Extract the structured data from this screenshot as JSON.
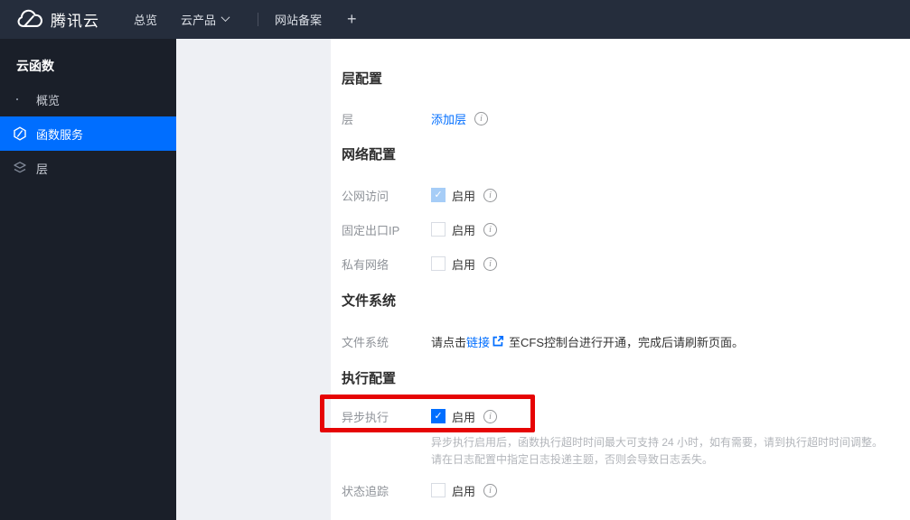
{
  "navbar": {
    "brand": "腾讯云",
    "items": [
      {
        "label": "总览"
      },
      {
        "label": "云产品"
      },
      {
        "label": "网站备案"
      },
      {
        "label": "+"
      }
    ]
  },
  "sidebar": {
    "title": "云函数",
    "items": [
      {
        "label": "概览",
        "active": false
      },
      {
        "label": "函数服务",
        "active": true
      },
      {
        "label": "层",
        "active": false
      }
    ]
  },
  "form": {
    "layer": {
      "heading": "层配置",
      "label": "层",
      "link": "添加层"
    },
    "network": {
      "heading": "网络配置",
      "rows": [
        {
          "label": "公网访问",
          "value": "启用",
          "checkbox_state": "checked-disabled"
        },
        {
          "label": "固定出口IP",
          "value": "启用",
          "checkbox_state": "unchecked"
        },
        {
          "label": "私有网络",
          "value": "启用",
          "checkbox_state": "unchecked"
        }
      ]
    },
    "filesystem": {
      "heading": "文件系统",
      "label": "文件系统",
      "text_before": "请点击",
      "link": "链接",
      "text_after": "至CFS控制台进行开通，完成后请刷新页面。"
    },
    "execution": {
      "heading": "执行配置",
      "async_row": {
        "label": "异步执行",
        "value": "启用",
        "checkbox_state": "checked"
      },
      "help_line1": "异步执行启用后，函数执行超时时间最大可支持 24 小时，如有需要，请到执行超时时间调整。",
      "help_line2": "请在日志配置中指定日志投递主题，否则会导致日志丢失。",
      "trace_row": {
        "label": "状态追踪",
        "value": "启用",
        "checkbox_state": "unchecked"
      }
    }
  },
  "icons": {
    "info": "i",
    "check": "✓"
  },
  "colors": {
    "accent_blue": "#006eff",
    "navbar_bg": "#252d3c",
    "sidebar_bg": "#1a1f29",
    "active_item_bg": "#006eff",
    "panel_bg": "#eef0f4",
    "annotation_red": "#e60404",
    "disabled_check_bg": "#a6cdf7"
  }
}
